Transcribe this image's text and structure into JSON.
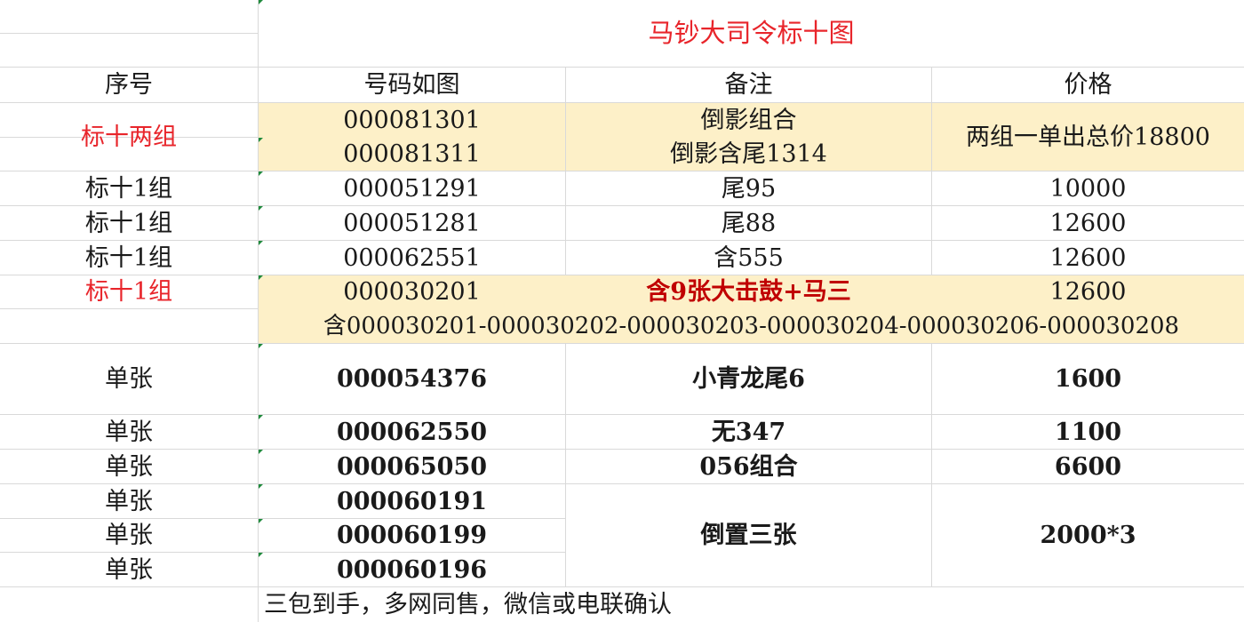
{
  "title": "马钞大司令标十图",
  "colors": {
    "highlight": "#fdf0c8",
    "red": "#e8252b",
    "dark_red": "#c00000",
    "grid": "#d9d9d9"
  },
  "headers": {
    "index": "序号",
    "number": "号码如图",
    "remark": "备注",
    "price": "价格"
  },
  "group_two": {
    "label": "标十两组",
    "numbers": [
      "000081301",
      "000081311"
    ],
    "remarks": [
      "倒影组合",
      "倒影含尾1314"
    ],
    "price": "两组一单出总价18800"
  },
  "rows_a": [
    {
      "label": "标十1组",
      "number": "000051291",
      "remark": "尾95",
      "price": "10000"
    },
    {
      "label": "标十1组",
      "number": "000051281",
      "remark": "尾88",
      "price": "12600"
    },
    {
      "label": "标十1组",
      "number": "000062551",
      "remark": "含555",
      "price": "12600"
    }
  ],
  "featured": {
    "label": "标十1组",
    "number": "000030201",
    "remark": "含9张大击鼓+马三",
    "price": "12600",
    "detail": "含000030201-000030202-000030203-000030204-000030206-000030208"
  },
  "singles": [
    {
      "label": "单张",
      "number": "000054376",
      "remark": "小青龙尾6",
      "price": "1600"
    },
    {
      "label": "单张",
      "number": "000062550",
      "remark": "无347",
      "price": "1100"
    },
    {
      "label": "单张",
      "number": "000065050",
      "remark": "056组合",
      "price": "6600"
    }
  ],
  "inverted": {
    "labels": [
      "单张",
      "单张",
      "单张"
    ],
    "numbers": [
      "000060191",
      "000060199",
      "000060196"
    ],
    "remark": "倒置三张",
    "price": "2000*3"
  },
  "footer_note": "三包到手，多网同售，微信或电联确认"
}
